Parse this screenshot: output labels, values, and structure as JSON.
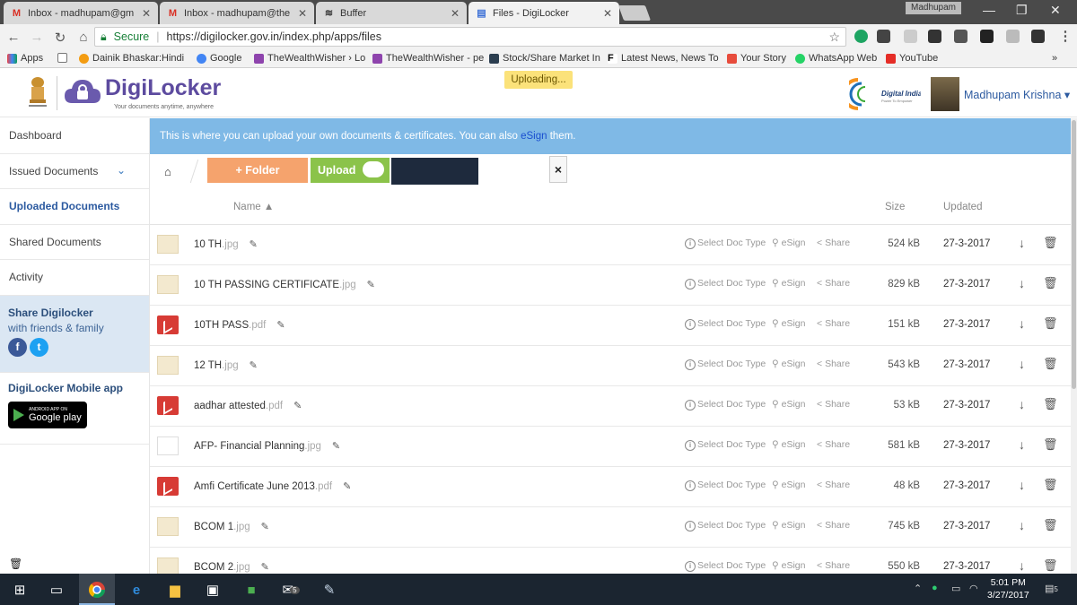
{
  "browser": {
    "tabs": [
      {
        "label": "Inbox - madhupam@gm",
        "icon": "gmail-icon"
      },
      {
        "label": "Inbox - madhupam@the",
        "icon": "gmail-icon"
      },
      {
        "label": "Buffer",
        "icon": "buffer-icon"
      },
      {
        "label": "Files - DigiLocker",
        "icon": "file-icon",
        "active": true
      }
    ],
    "close_glyph": "✕",
    "profile": "Madhupam",
    "secure_label": "Secure",
    "url": "https://digilocker.gov.in/index.php/apps/files",
    "bookmarks": [
      {
        "label": "Apps",
        "color": "#e44"
      },
      {
        "label": "",
        "color": "#fff"
      },
      {
        "label": "Dainik Bhaskar:Hindi",
        "color": "#f39c12"
      },
      {
        "label": "Google",
        "color": "#4285f4"
      },
      {
        "label": "TheWealthWisher › Lo",
        "color": "#8e44ad"
      },
      {
        "label": "TheWealthWisher - pe",
        "color": "#8e44ad"
      },
      {
        "label": "Stock/Share Market In",
        "color": "#2c3e50"
      },
      {
        "label": "Latest News, News To",
        "color": "#000"
      },
      {
        "label": "Your Story",
        "color": "#e74c3c"
      },
      {
        "label": "WhatsApp Web",
        "color": "#25d366"
      },
      {
        "label": "YouTube",
        "color": "#e52d27"
      }
    ],
    "more_bookmarks": "»"
  },
  "header": {
    "brand": "DigiLocker",
    "tagline": "Your documents anytime, anywhere",
    "status_toast": "Uploading...",
    "user_name": "Madhupam Krishna ▾",
    "digital_india": "Digital India",
    "digital_india_sub": "Power To Empower"
  },
  "sidebar": {
    "items": [
      {
        "label": "Dashboard"
      },
      {
        "label": "Issued Documents"
      },
      {
        "label": "Uploaded Documents",
        "active": true
      },
      {
        "label": "Shared Documents"
      },
      {
        "label": "Activity"
      }
    ],
    "share_title": "Share Digilocker",
    "share_sub": "with friends & family",
    "mobile_title": "DigiLocker Mobile app",
    "gplay_small": "ANDROID APP ON",
    "gplay_big": "Google play"
  },
  "main": {
    "info_text": "This is where you can upload your own documents & certificates. You can also ",
    "info_link": "eSign",
    "info_tail": " them.",
    "folder_button": "+ Folder",
    "upload_button": "Upload",
    "close_glyph": "×",
    "columns": {
      "name": "Name ▲",
      "size": "Size",
      "updated": "Updated"
    },
    "action_labels": {
      "doc_type": "Select Doc Type",
      "esign": "eSign",
      "share": "Share"
    },
    "files": [
      {
        "name": "10 TH",
        "ext": ".jpg",
        "type": "img",
        "size": "524 kB",
        "updated": "27-3-2017"
      },
      {
        "name": "10 TH PASSING CERTIFICATE",
        "ext": ".jpg",
        "type": "img",
        "size": "829 kB",
        "updated": "27-3-2017"
      },
      {
        "name": "10TH PASS",
        "ext": ".pdf",
        "type": "pdf",
        "size": "151 kB",
        "updated": "27-3-2017"
      },
      {
        "name": "12 TH",
        "ext": ".jpg",
        "type": "img",
        "size": "543 kB",
        "updated": "27-3-2017"
      },
      {
        "name": "aadhar attested",
        "ext": ".pdf",
        "type": "pdf",
        "size": "53 kB",
        "updated": "27-3-2017"
      },
      {
        "name": "AFP- Financial Planning",
        "ext": ".jpg",
        "type": "doc",
        "size": "581 kB",
        "updated": "27-3-2017"
      },
      {
        "name": "Amfi Certificate June 2013",
        "ext": ".pdf",
        "type": "pdf",
        "size": "48 kB",
        "updated": "27-3-2017"
      },
      {
        "name": "BCOM 1",
        "ext": ".jpg",
        "type": "img",
        "size": "745 kB",
        "updated": "27-3-2017"
      },
      {
        "name": "BCOM 2",
        "ext": ".jpg",
        "type": "img",
        "size": "550 kB",
        "updated": "27-3-2017"
      }
    ]
  },
  "taskbar": {
    "time": "5:01 PM",
    "date": "3/27/2017",
    "notification_count": "5",
    "mail_badge": "5"
  },
  "colors": {
    "brand_purple": "#5d4b9f",
    "info_blue": "#7fb9e6",
    "folder_orange": "#f5a36d",
    "upload_green": "#8bc34a",
    "toast_yellow": "#fbe27a"
  }
}
